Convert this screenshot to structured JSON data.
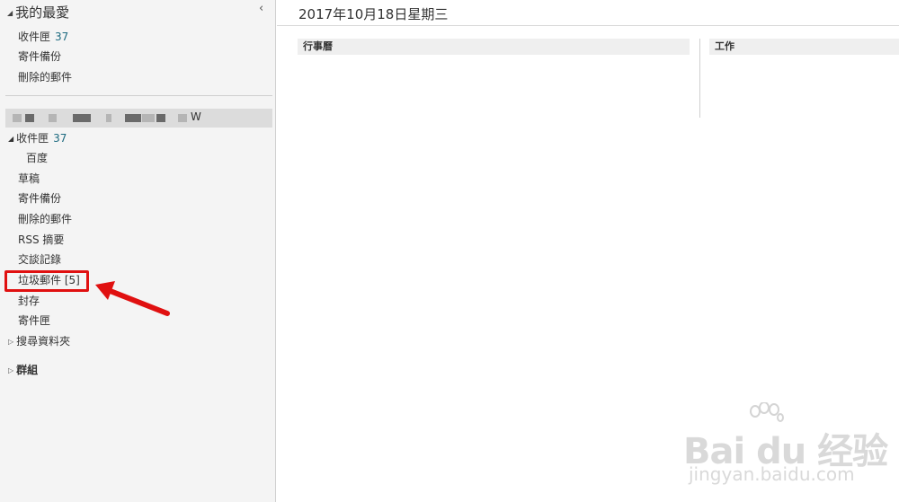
{
  "sidebar": {
    "favorites_title": "我的最愛",
    "collapse_glyph": "‹",
    "favorites": [
      {
        "label": "收件匣",
        "count": "37"
      },
      {
        "label": "寄件備份",
        "count": ""
      },
      {
        "label": "刪除的郵件",
        "count": ""
      }
    ],
    "account_suffix": "W",
    "folders": [
      {
        "label": "收件匣",
        "count": "37"
      },
      {
        "label": "百度",
        "count": ""
      },
      {
        "label": "草稿",
        "count": ""
      },
      {
        "label": "寄件備份",
        "count": ""
      },
      {
        "label": "刪除的郵件",
        "count": ""
      },
      {
        "label": "RSS 摘要",
        "count": ""
      },
      {
        "label": "交談記錄",
        "count": ""
      },
      {
        "label": "垃圾郵件 [5]",
        "count": ""
      },
      {
        "label": "封存",
        "count": ""
      },
      {
        "label": "寄件匣",
        "count": ""
      },
      {
        "label": "搜尋資料夾",
        "count": ""
      }
    ],
    "groups_label": "群組"
  },
  "main": {
    "date_header": "2017年10月18日星期三",
    "columns": [
      "行事曆",
      "工作"
    ]
  },
  "watermark": {
    "brand": "Bai du 经验",
    "url": "jingyan.baidu.com"
  },
  "colors": {
    "highlight": "#e01010",
    "count": "#1e6b80",
    "sidebar_bg": "#f4f4f4"
  }
}
